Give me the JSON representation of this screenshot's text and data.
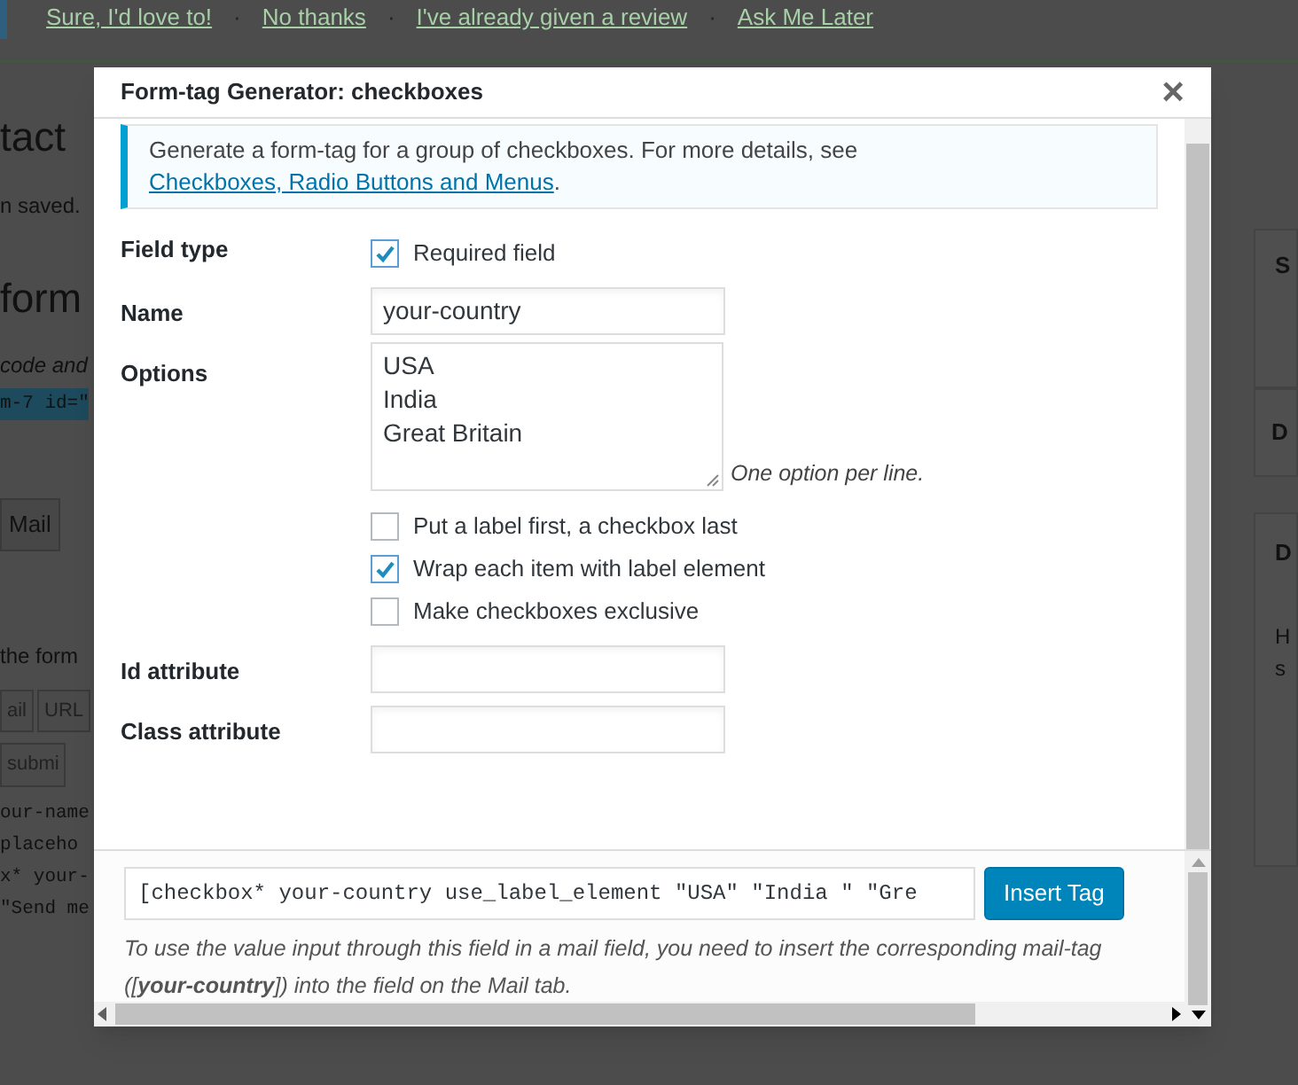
{
  "background": {
    "notice_links": [
      {
        "label": "Sure, I'd love to!"
      },
      {
        "label": "No thanks",
        "separator": "·"
      },
      {
        "label": "I've already given a review",
        "separator": "·"
      },
      {
        "label": "Ask Me Later",
        "separator": "·"
      }
    ],
    "left_fragments": [
      {
        "kind": "heading",
        "text": "tact"
      },
      {
        "kind": "note",
        "text": "n saved."
      },
      {
        "kind": "heading",
        "text": "form"
      },
      {
        "kind": "italic",
        "text": "code and"
      },
      {
        "kind": "code",
        "text": "m-7 id=\""
      },
      {
        "kind": "tab",
        "text": "Mail"
      },
      {
        "kind": "note",
        "text": "the form"
      },
      {
        "kind": "buttons",
        "items": [
          "ail",
          "URL"
        ]
      },
      {
        "kind": "buttons",
        "items": [
          "submi"
        ]
      },
      {
        "kind": "code",
        "text": "our-name"
      },
      {
        "kind": "code",
        "text": "placeho"
      },
      {
        "kind": "code",
        "text": "x* your-"
      },
      {
        "kind": "code",
        "text": "\"Send me"
      }
    ],
    "right_fragments": [
      {
        "kind": "panel-title",
        "text": "S"
      },
      {
        "kind": "panel-title",
        "text": "D"
      },
      {
        "kind": "panel-title",
        "text": "D"
      },
      {
        "kind": "note",
        "text": "H"
      },
      {
        "kind": "note",
        "text": "s"
      }
    ]
  },
  "dialog": {
    "title": "Form-tag Generator: checkboxes",
    "close": "×",
    "intro": {
      "text": "Generate a form-tag for a group of checkboxes. For more details, see ",
      "link": "Checkboxes, Radio Buttons and Menus",
      "end": "."
    },
    "rows": [
      {
        "label": "Field type",
        "kind": "checkboxes",
        "checkboxes": [
          {
            "label": "Required field",
            "checked": true
          }
        ]
      },
      {
        "label": "Name",
        "kind": "text",
        "value": "your-country"
      },
      {
        "label": "Options",
        "kind": "textarea",
        "value": "USA\nIndia\nGreat Britain",
        "hint": "One option per line.",
        "checkboxes": [
          {
            "label": "Put a label first, a checkbox last",
            "checked": false
          },
          {
            "label": "Wrap each item with label element",
            "checked": true
          },
          {
            "label": "Make checkboxes exclusive",
            "checked": false
          }
        ]
      },
      {
        "label": "Id attribute",
        "kind": "text"
      },
      {
        "label": "Class attribute",
        "kind": "text"
      }
    ],
    "tag": "[checkbox* your-country use_label_element \"USA\" \"India \" \"Gre",
    "insert_button": "Insert Tag",
    "mail_note": "To use the value input through this field in a mail field, you need to insert the corresponding mail-tag ([**your-country**]) into the field on the Mail tab."
  }
}
